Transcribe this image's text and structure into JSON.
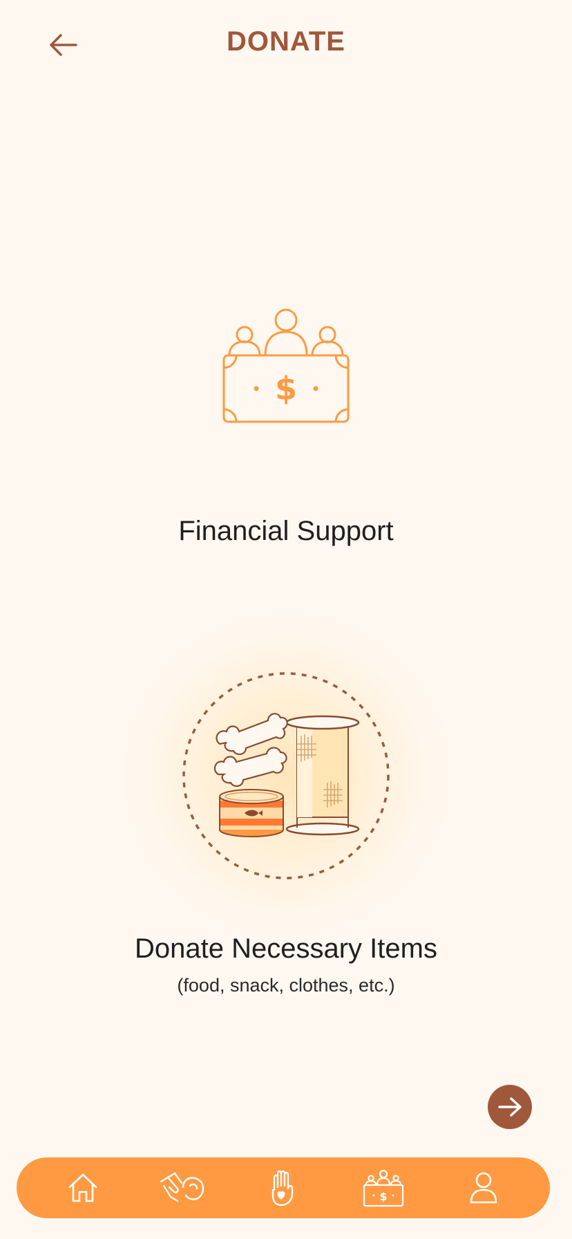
{
  "header": {
    "title": "DONATE",
    "back_icon": "arrow-left-icon"
  },
  "options": {
    "financial": {
      "label": "Financial Support",
      "icon": "money-people-icon"
    },
    "items": {
      "label": "Donate Necessary Items",
      "sublabel": "(food, snack, clothes, etc.)",
      "icon": "pet-supplies-illustration",
      "selected": true
    }
  },
  "next_button": {
    "icon": "arrow-right-icon"
  },
  "bottom_nav": {
    "items": [
      {
        "icon": "home-icon"
      },
      {
        "icon": "pet-hand-icon"
      },
      {
        "icon": "hand-heart-icon"
      },
      {
        "icon": "donate-icon",
        "active": true
      },
      {
        "icon": "user-icon"
      }
    ]
  },
  "colors": {
    "background": "#FFF8F1",
    "accent": "#FF9A42",
    "brown": "#A0583A"
  }
}
